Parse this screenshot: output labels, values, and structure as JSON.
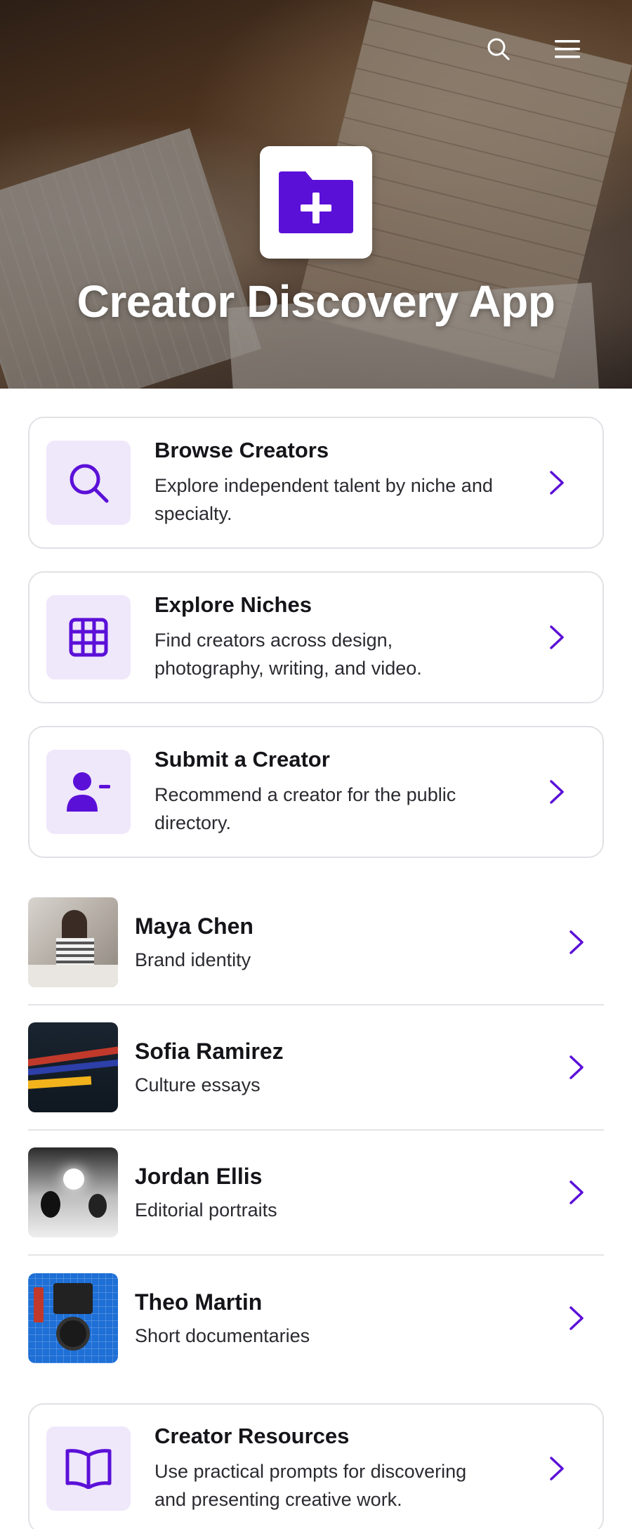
{
  "header": {
    "title": "Creator Discovery App",
    "search_icon": "search-icon",
    "menu_icon": "hamburger-menu-icon",
    "logo_icon": "folder-plus-icon"
  },
  "colors": {
    "accent": "#5b10d8",
    "accent_light": "#efe7fa",
    "border": "#e1e1e6"
  },
  "cards": [
    {
      "title": "Browse Creators",
      "description": "Explore independent talent by niche and specialty.",
      "icon": "search-icon"
    },
    {
      "title": "Explore Niches",
      "description": "Find creators across design, photography, writing, and video.",
      "icon": "grid-icon"
    },
    {
      "title": "Submit a Creator",
      "description": "Recommend a creator for the public directory.",
      "icon": "user-minus-icon"
    }
  ],
  "creators": [
    {
      "name": "Maya Chen",
      "specialty": "Brand identity"
    },
    {
      "name": "Sofia Ramirez",
      "specialty": "Culture essays"
    },
    {
      "name": "Jordan Ellis",
      "specialty": "Editorial portraits"
    },
    {
      "name": "Theo Martin",
      "specialty": "Short documentaries"
    }
  ],
  "resources": {
    "title": "Creator Resources",
    "description": "Use practical prompts for discovering and presenting creative work.",
    "icon": "book-open-icon"
  }
}
